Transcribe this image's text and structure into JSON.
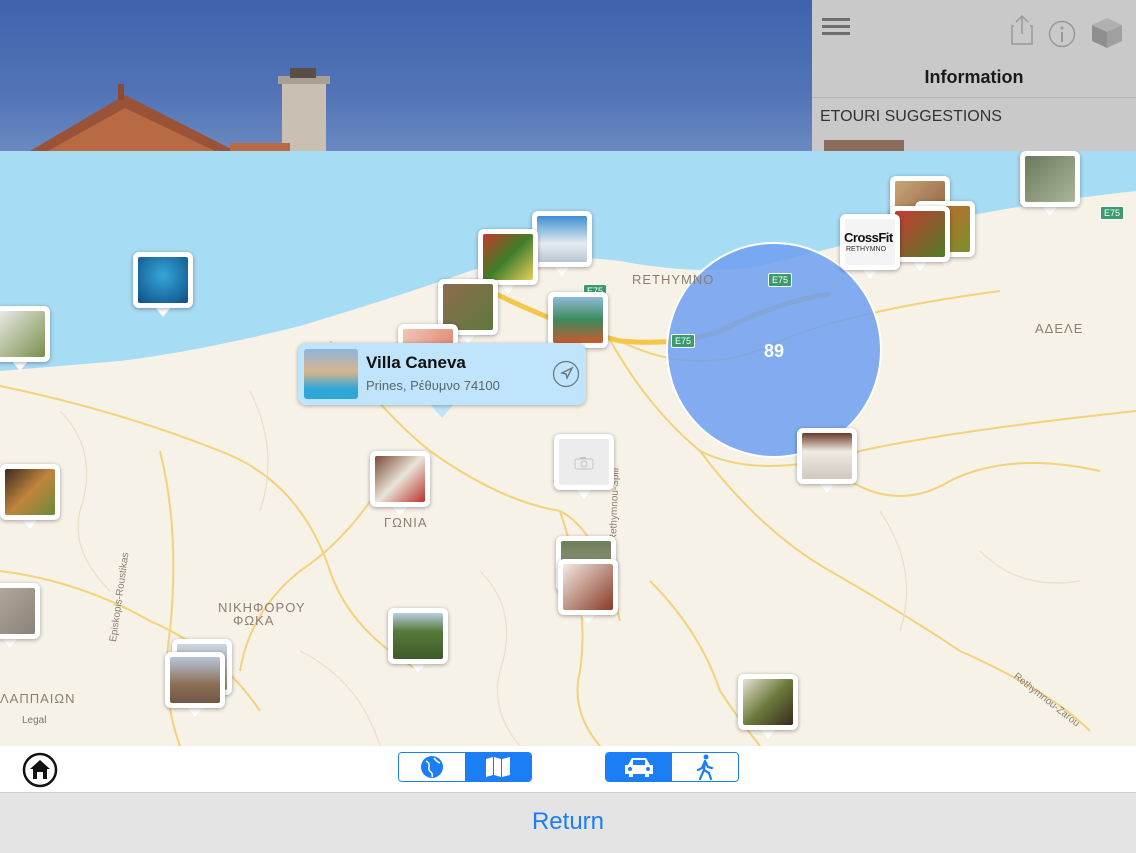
{
  "panel": {
    "title": "Information",
    "section_header": "ETOURI SUGGESTIONS"
  },
  "map": {
    "labels": {
      "rethymno": "RETHYMNO",
      "adele": "ΑΔΕΛΕ",
      "nikiforou_1": "ΝΙΚΗΦΟΡΟΥ",
      "nikiforou_2": "ΦΩΚΑ",
      "lappaion": "ΛΑΠΠΑΙΩΝ",
      "gonia": "ΓΩΝΙΑ",
      "episkopis_road": "Episkopis-Roustikas",
      "spili_road": "Rethymnou-Spili",
      "zarou_road": "Rethymnou-Zarou",
      "legal": "Legal"
    },
    "road_shields": [
      "E75",
      "E75",
      "E75",
      "E75"
    ],
    "cluster_count": "89"
  },
  "callout": {
    "title": "Villa Caneva",
    "subtitle": "Prines, Ρέθυμνο 74100"
  },
  "bottom": {
    "return_label": "Return"
  },
  "colors": {
    "accent": "#1c7ef5",
    "sea": "#a7dcf5",
    "land": "#f7f2e8",
    "cluster": "#6f9ff0"
  }
}
